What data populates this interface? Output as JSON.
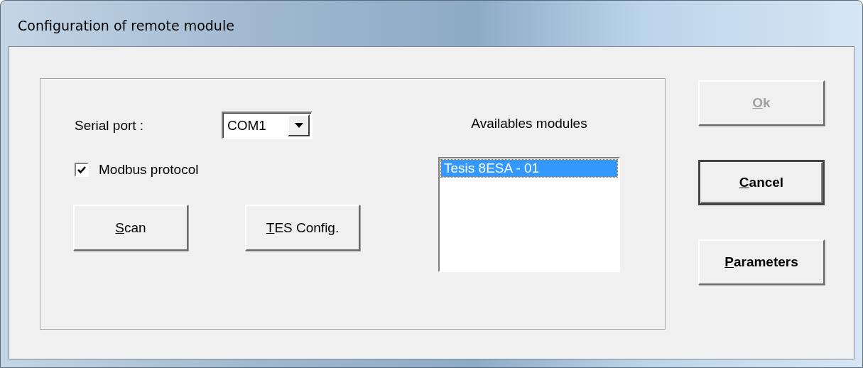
{
  "window": {
    "title": "Configuration of remote module"
  },
  "serial_port": {
    "label": "Serial port :",
    "value": "COM1"
  },
  "modbus": {
    "label": "Modbus protocol",
    "checked": true
  },
  "left_buttons": [
    {
      "key": "S",
      "rest": "can",
      "disabled": false
    },
    {
      "key": "T",
      "rest": "ES Config.",
      "disabled": false
    }
  ],
  "modules": {
    "label": "Availables modules",
    "items": [
      {
        "text": "Tesis 8ESA - 01",
        "selected": true
      }
    ]
  },
  "side_buttons": [
    {
      "key": "O",
      "rest": "k",
      "disabled": true,
      "default": false
    },
    {
      "key": "C",
      "rest": "ancel",
      "disabled": false,
      "default": true
    },
    {
      "key": "P",
      "rest": "arameters",
      "disabled": false,
      "default": false
    }
  ]
}
